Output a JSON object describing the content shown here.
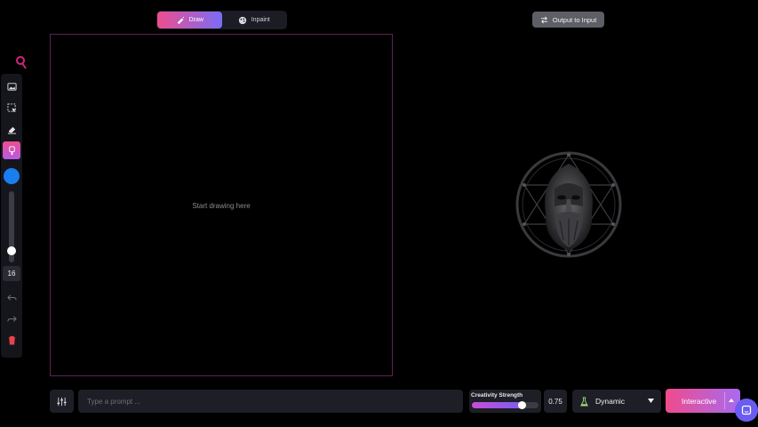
{
  "mode_toggle": {
    "tabs": [
      {
        "label": "Draw",
        "icon": "brush-icon",
        "active": true
      },
      {
        "label": "Inpaint",
        "icon": "palette-icon",
        "active": false
      }
    ]
  },
  "output_to_input": {
    "label": "Output to Input",
    "icon": "swap-icon"
  },
  "toolbar": {
    "tools": [
      "image-upload-icon",
      "select-icon",
      "eraser-icon",
      "brush-icon"
    ],
    "active_tool": "brush-icon",
    "brush_color": "#1a7df0",
    "brush_size": "16",
    "brush_size_level": 0.12
  },
  "canvas": {
    "hint": "Start drawing here"
  },
  "prompt": {
    "placeholder": "Type a prompt ..."
  },
  "creativity": {
    "label": "Creativity Strength",
    "value": "0.75",
    "level": 0.75
  },
  "style": {
    "selected": "Dynamic",
    "icon": "flask-icon"
  },
  "mode": {
    "label": "Interactive"
  },
  "colors": {
    "accent_pink": "#ee4d8f",
    "accent_purple": "#7a6cf5",
    "panel": "#1d1e26"
  }
}
